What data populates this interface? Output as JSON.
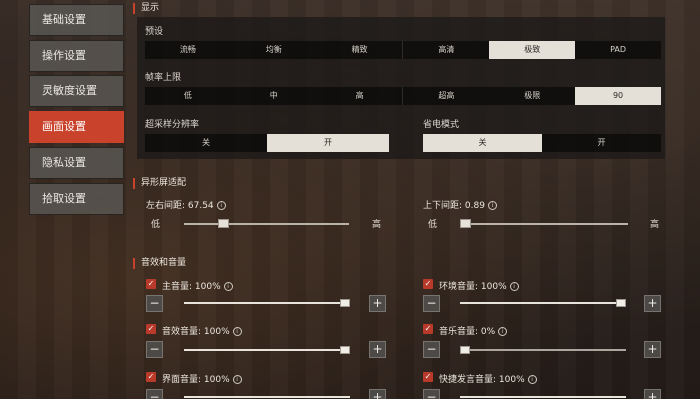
{
  "sidebar": {
    "items": [
      {
        "label": "基础设置"
      },
      {
        "label": "操作设置"
      },
      {
        "label": "灵敏度设置"
      },
      {
        "label": "画面设置"
      },
      {
        "label": "隐私设置"
      },
      {
        "label": "拾取设置"
      }
    ],
    "active_index": 3
  },
  "display": {
    "title": "显示",
    "preset_label": "预设",
    "preset_options": [
      "流畅",
      "均衡",
      "精致",
      "高清",
      "极致",
      "PAD"
    ],
    "preset_selected": "极致",
    "fps_label": "帧率上限",
    "fps_options": [
      "低",
      "中",
      "高",
      "超高",
      "极限",
      "90"
    ],
    "fps_selected": "90",
    "super_res_label": "超采样分辨率",
    "super_res_options": [
      "关",
      "开"
    ],
    "super_res_selected": "开",
    "power_save_label": "省电模式",
    "power_save_options": [
      "关",
      "开"
    ],
    "power_save_selected": "关"
  },
  "screen_adapt": {
    "title": "异形屏适配",
    "lr_label": "左右间距: 67.54",
    "lr_fraction": 0.24,
    "tb_label": "上下间距: 0.89",
    "tb_fraction": 0.02,
    "low_label": "低",
    "high_label": "高"
  },
  "audio": {
    "title": "音效和音量",
    "volumes": [
      {
        "label": "主音量: 100%",
        "checked": true,
        "value": 1.0
      },
      {
        "label": "环境音量: 100%",
        "checked": true,
        "value": 1.0
      },
      {
        "label": "音效音量: 100%",
        "checked": true,
        "value": 1.0
      },
      {
        "label": "音乐音量: 0%",
        "checked": true,
        "value": 0.0
      },
      {
        "label": "界面音量: 100%",
        "checked": true,
        "value": 1.0
      },
      {
        "label": "快捷发言音量: 100%",
        "checked": true,
        "value": 1.0
      }
    ],
    "minus": "−",
    "plus": "+",
    "check_mark": "✓",
    "info_mark": "i"
  }
}
